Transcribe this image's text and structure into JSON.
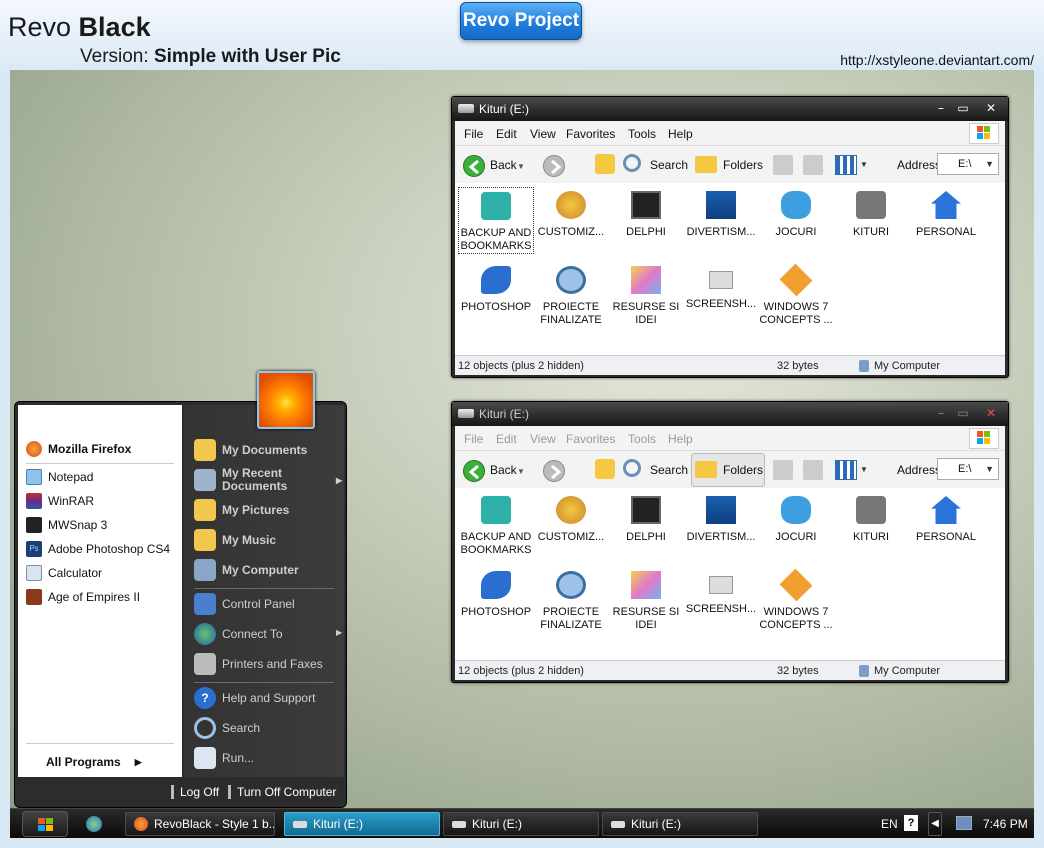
{
  "header": {
    "brand_a": "Revo",
    "brand_b": "Black",
    "version_label": "Version:",
    "version_value": "Simple with User Pic",
    "project_button": "Revo Project",
    "url": "http://xstyleone.deviantart.com/"
  },
  "explorer": {
    "title": "Kituri (E:)",
    "menu": [
      "File",
      "Edit",
      "View",
      "Favorites",
      "Tools",
      "Help"
    ],
    "toolbar": {
      "back": "Back",
      "search": "Search",
      "folders": "Folders",
      "address_label": "Address",
      "address_value": "E:\\"
    },
    "items": [
      "BACKUP AND BOOKMARKS",
      "CUSTOMIZ...",
      "DELPHI",
      "DIVERTISM...",
      "JOCURI",
      "KITURI",
      "PERSONAL",
      "PHOTOSHOP",
      "PROIECTE FINALIZATE",
      "RESURSE SI IDEI",
      "SCREENSH...",
      "WINDOWS 7 CONCEPTS ..."
    ],
    "status": {
      "objects": "12 objects (plus 2 hidden)",
      "size": "32 bytes",
      "location": "My Computer"
    }
  },
  "start_menu": {
    "pinned": "Mozilla Firefox",
    "recent": [
      "Notepad",
      "WinRAR",
      "MWSnap 3",
      "Adobe Photoshop CS4",
      "Calculator",
      "Age of Empires II"
    ],
    "all_programs": "All Programs",
    "right": [
      "My Documents",
      "My Recent Documents",
      "My Pictures",
      "My Music",
      "My Computer",
      "Control Panel",
      "Connect To",
      "Printers and Faxes",
      "Help and Support",
      "Search",
      "Run..."
    ],
    "log_off": "Log Off",
    "turn_off": "Turn Off Computer"
  },
  "taskbar": {
    "buttons": [
      "RevoBlack - Style 1 b...",
      "Kituri (E:)",
      "Kituri (E:)",
      "Kituri (E:)"
    ],
    "lang": "EN",
    "clock": "7:46 PM"
  },
  "colors": {
    "accent": "#1f7fe0",
    "active_task": "#1a7fa8",
    "window_frame": "#2b2b2b"
  }
}
